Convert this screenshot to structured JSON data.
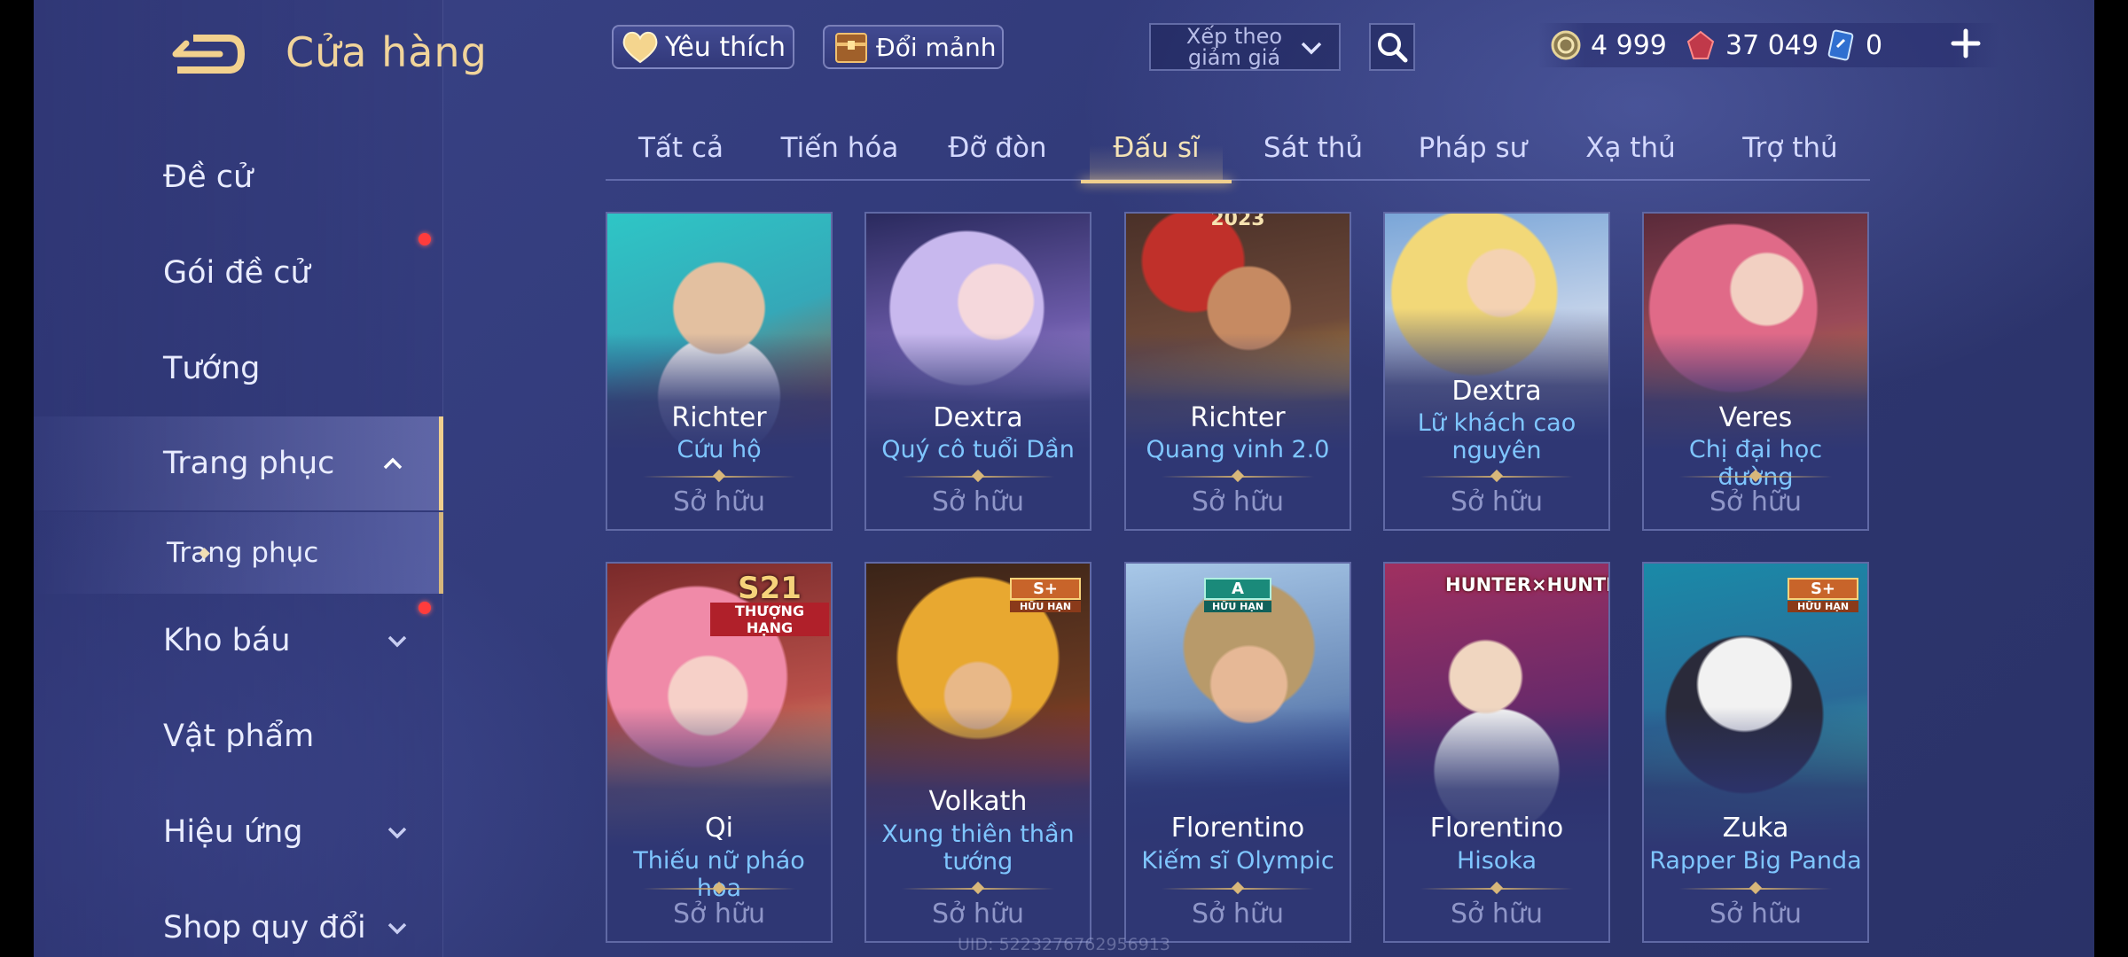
{
  "app": {
    "title": "Cửa hàng"
  },
  "top": {
    "favorites_label": "Yêu thích",
    "exchange_label": "Đổi mảnh",
    "sort_label": "Xếp theo giảm giá",
    "currency": [
      {
        "name": "vàng",
        "value": "4 999",
        "icon": "gold-coin-icon",
        "color": "#d9c58a"
      },
      {
        "name": "quân huy",
        "value": "37 049",
        "icon": "red-gem-icon",
        "color": "#e05a5a"
      },
      {
        "name": "phiếu",
        "value": "0",
        "icon": "blue-voucher-icon",
        "color": "#5aa8f0"
      }
    ]
  },
  "sidebar": {
    "items": [
      {
        "label": "Đề cử"
      },
      {
        "label": "Gói đề cử"
      },
      {
        "label": "Tướng"
      },
      {
        "label": "Trang phục"
      },
      {
        "label": "Kho báu"
      },
      {
        "label": "Vật phẩm"
      },
      {
        "label": "Hiệu ứng"
      },
      {
        "label": "Shop quy đổi"
      }
    ],
    "sub_item": "Trang phục"
  },
  "tabs": [
    "Tất cả",
    "Tiến hóa",
    "Đỡ đòn",
    "Đấu sĩ",
    "Sát thủ",
    "Pháp sư",
    "Xạ thủ",
    "Trợ thủ"
  ],
  "active_tab": "Đấu sĩ",
  "cards": [
    {
      "hero": "Richter",
      "skin": "Cứu hộ",
      "status": "Sở hữu"
    },
    {
      "hero": "Dextra",
      "skin": "Quý cô tuổi Dần",
      "status": "Sở hữu"
    },
    {
      "hero": "Richter",
      "skin": "Quang vinh 2.0",
      "status": "Sở hữu",
      "badge": "2023"
    },
    {
      "hero": "Dextra",
      "skin": "Lữ khách cao nguyên",
      "status": "Sở hữu"
    },
    {
      "hero": "Veres",
      "skin": "Chị đại học đường",
      "status": "Sở hữu"
    },
    {
      "hero": "Qi",
      "skin": "Thiếu nữ pháo hoa",
      "status": "Sở hữu",
      "badge": "S21",
      "badge_sub": "THƯỢNG HẠNG"
    },
    {
      "hero": "Volkath",
      "skin": "Xung thiên thần tướng",
      "status": "Sở hữu",
      "badge": "S+",
      "badge_sub": "HỮU HẠN"
    },
    {
      "hero": "Florentino",
      "skin": "Kiếm sĩ Olympic",
      "status": "Sở hữu",
      "badge": "A",
      "badge_sub": "HỮU HẠN"
    },
    {
      "hero": "Florentino",
      "skin": "Hisoka",
      "status": "Sở hữu",
      "badge": "HUNTER×HUNTER"
    },
    {
      "hero": "Zuka",
      "skin": "Rapper Big Panda",
      "status": "Sở hữu",
      "badge": "S+",
      "badge_sub": "HỮU HẠN"
    }
  ],
  "footer": {
    "uid": "UID: 5223276762956913"
  }
}
